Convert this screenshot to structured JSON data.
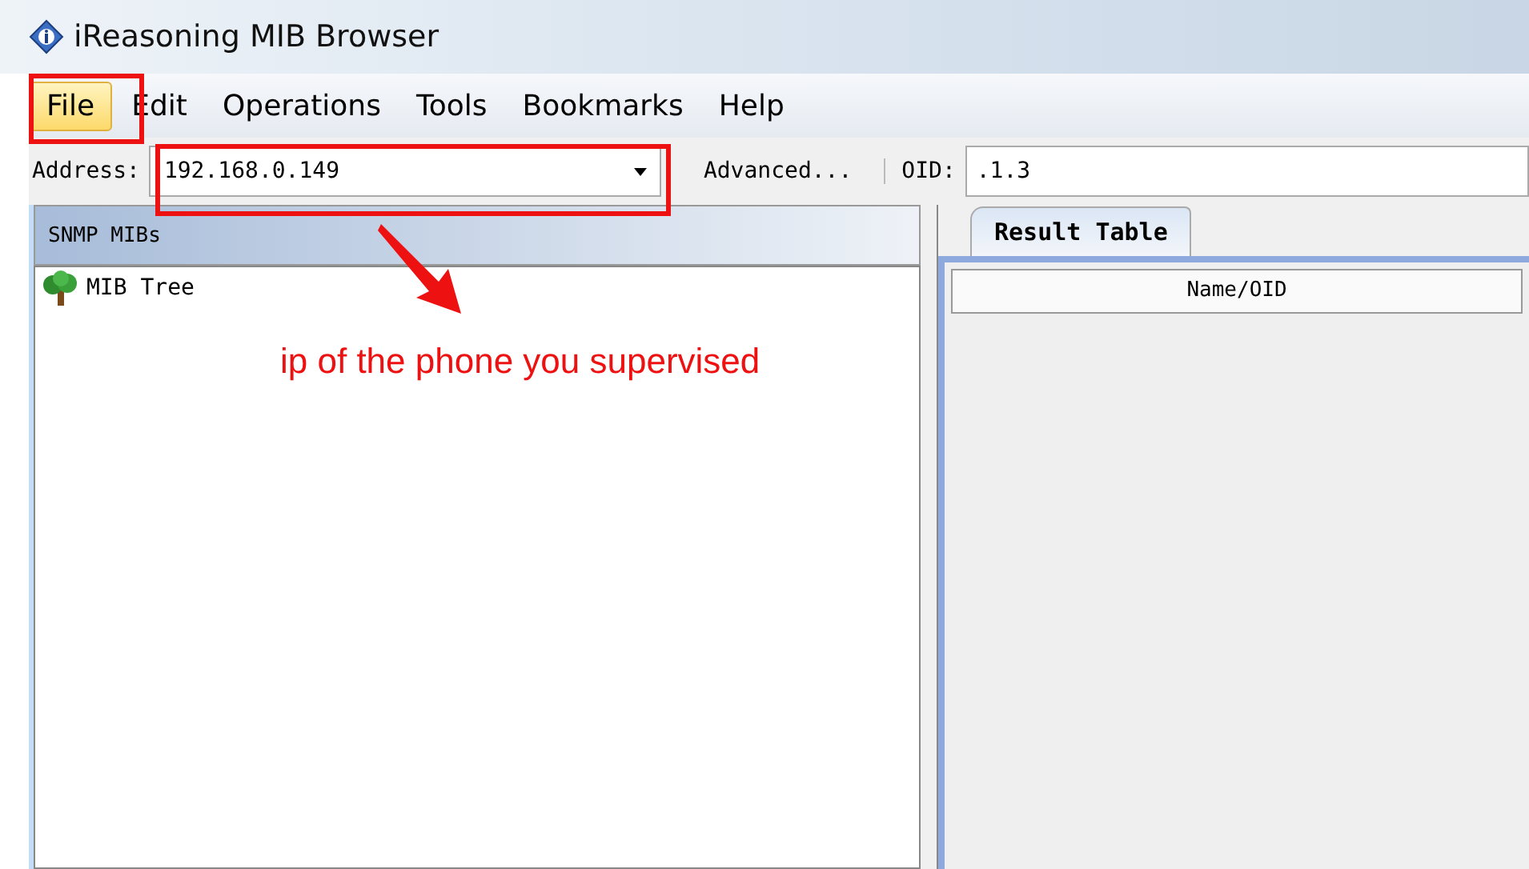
{
  "window": {
    "title": "iReasoning MIB Browser"
  },
  "menu": [
    {
      "label": "File",
      "selected": true
    },
    {
      "label": "Edit",
      "selected": false
    },
    {
      "label": "Operations",
      "selected": false
    },
    {
      "label": "Tools",
      "selected": false
    },
    {
      "label": "Bookmarks",
      "selected": false
    },
    {
      "label": "Help",
      "selected": false
    }
  ],
  "address": {
    "label": "Address:",
    "value": "192.168.0.149"
  },
  "advanced_button": "Advanced...",
  "oid": {
    "label": "OID:",
    "value": ".1.3"
  },
  "mib_panel": {
    "title": "SNMP MIBs",
    "tree": [
      {
        "label": "MIB Tree"
      }
    ]
  },
  "tabs": [
    {
      "label": "Result Table",
      "selected": true
    }
  ],
  "table": {
    "columns": [
      "Name/OID"
    ]
  },
  "annotation": {
    "text": "ip of the phone you supervised"
  }
}
